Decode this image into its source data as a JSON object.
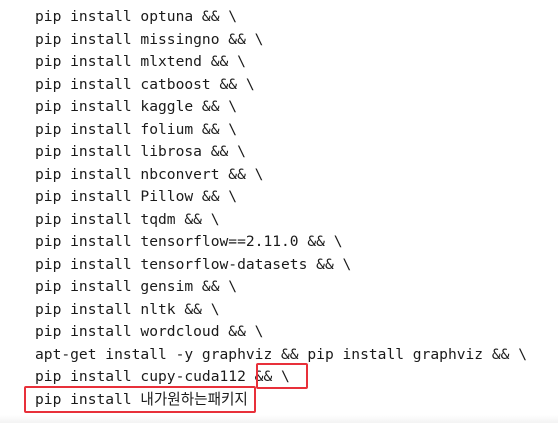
{
  "code": {
    "lines": [
      "pip install optuna && \\",
      "pip install missingno && \\",
      "pip install mlxtend && \\",
      "pip install catboost && \\",
      "pip install kaggle && \\",
      "pip install folium && \\",
      "pip install librosa && \\",
      "pip install nbconvert && \\",
      "pip install Pillow && \\",
      "pip install tqdm && \\",
      "pip install tensorflow==2.11.0 && \\",
      "pip install tensorflow-datasets && \\",
      "pip install gensim && \\",
      "pip install nltk && \\",
      "pip install wordcloud && \\",
      "apt-get install -y graphviz && pip install graphviz && \\",
      "pip install cupy-cuda112 && \\",
      "pip install 내가원하는패키지"
    ]
  },
  "highlights": {
    "color": "#e8303a"
  }
}
